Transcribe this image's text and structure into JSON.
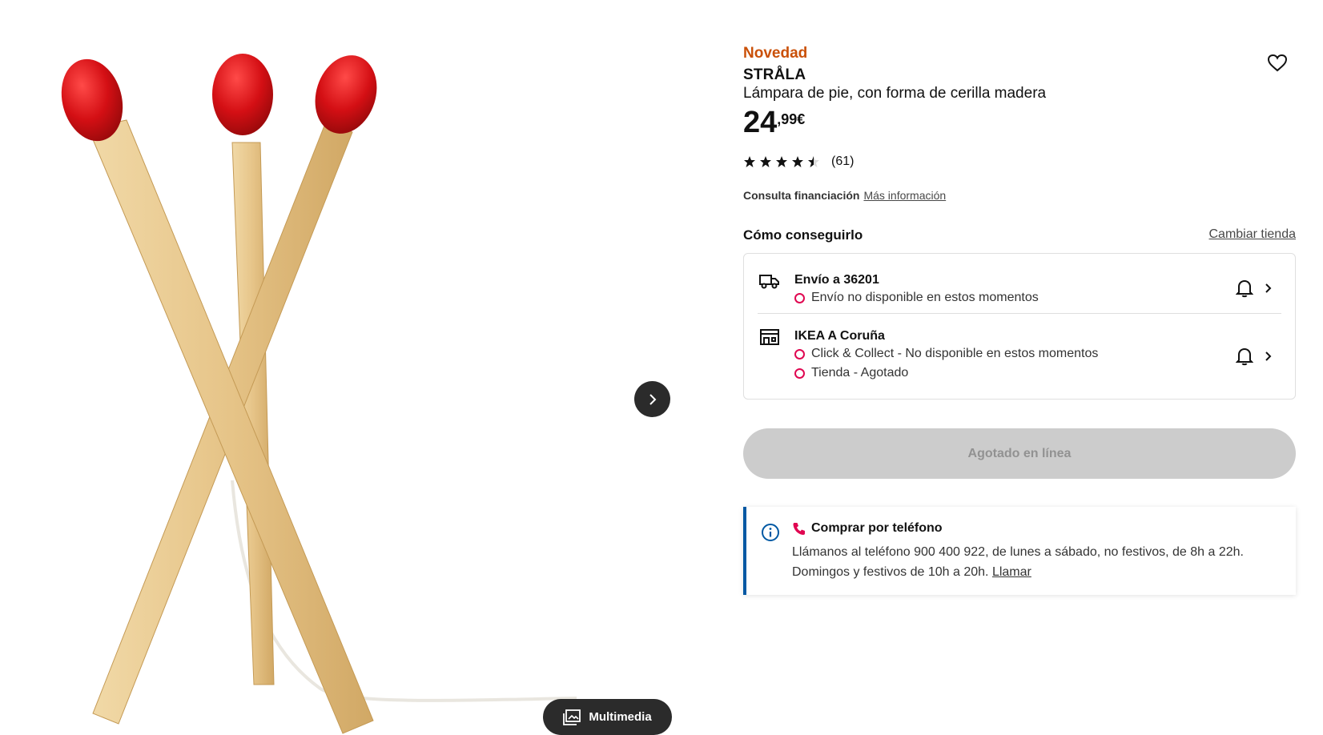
{
  "product": {
    "badge": "Novedad",
    "name": "STRÅLA",
    "description": "Lámpara de pie, con forma de cerilla madera",
    "price_integer": "24",
    "price_decimal": ",99€",
    "rating_value": 4.5,
    "rating_count": "(61)"
  },
  "financing": {
    "label": "Consulta financiación",
    "link": "Más información"
  },
  "availability": {
    "title": "Cómo conseguirlo",
    "change_store": "Cambiar tienda",
    "delivery": {
      "title": "Envío a 36201",
      "status": "Envío no disponible en estos momentos"
    },
    "store": {
      "title": "IKEA A Coruña",
      "status_click_collect": "Click & Collect - No disponible en estos momentos",
      "status_store": "Tienda - Agotado"
    }
  },
  "buttons": {
    "sold_out": "Agotado en línea",
    "multimedia": "Multimedia"
  },
  "phone": {
    "title": "Comprar por teléfono",
    "text": "Llámanos al teléfono 900 400 922, de lunes a sábado, no festivos, de 8h a 22h. Domingos y festivos de 10h a 20h.",
    "link": "Llamar"
  },
  "icons": {
    "favorite": "heart-icon",
    "next": "chevron-right-icon",
    "multimedia": "gallery-icon",
    "delivery": "truck-icon",
    "store": "store-icon",
    "notify": "bell-icon",
    "info": "info-icon",
    "phone": "phone-icon"
  },
  "colors": {
    "badge": "#ca5008",
    "status_dot": "#e00751",
    "info_accent": "#0058a3",
    "phone_icon": "#e00751",
    "match_head": "#d40f14",
    "wood": "#e8c98e"
  }
}
